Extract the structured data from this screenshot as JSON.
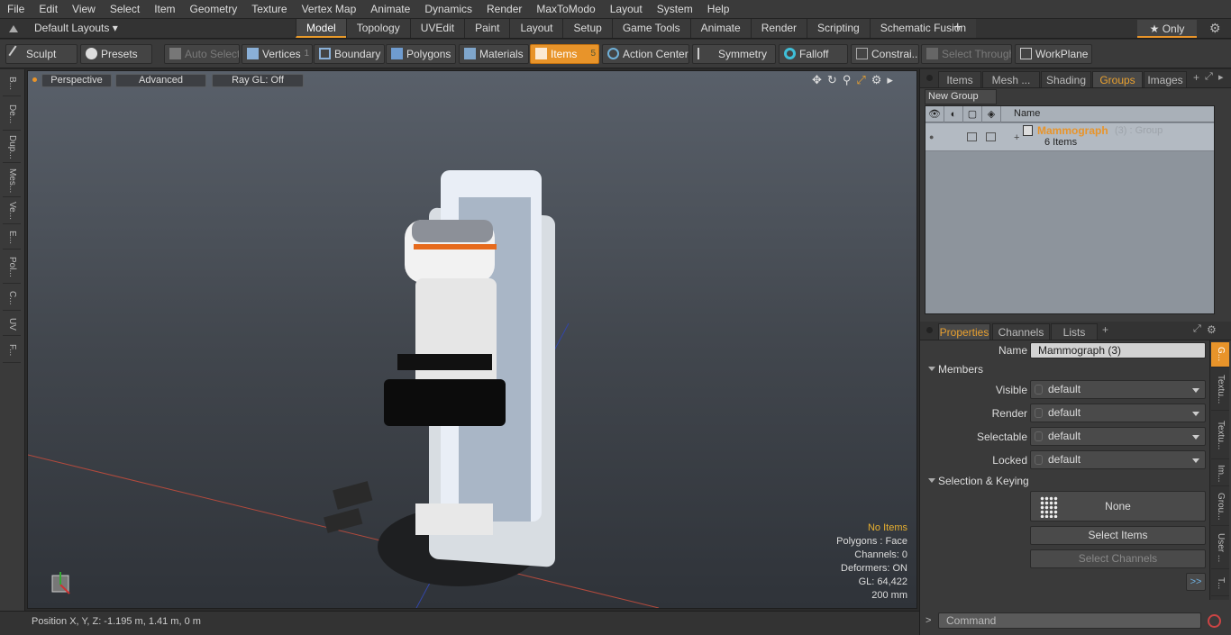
{
  "menu": [
    "File",
    "Edit",
    "View",
    "Select",
    "Item",
    "Geometry",
    "Texture",
    "Vertex Map",
    "Animate",
    "Dynamics",
    "Render",
    "MaxToModo",
    "Layout",
    "System",
    "Help"
  ],
  "layouts": {
    "label": "Default Layouts ▾"
  },
  "mode_tabs": [
    "Model",
    "Topology",
    "UVEdit",
    "Paint",
    "Layout",
    "Setup",
    "Game Tools",
    "Animate",
    "Render",
    "Scripting",
    "Schematic Fusion"
  ],
  "only_label": "★ Only",
  "toolbar": {
    "sculpt": "Sculpt",
    "presets": "Presets",
    "auto_select": "Auto Select",
    "vertices": "Vertices",
    "vertices_count": "1",
    "boundary": "Boundary",
    "polygons": "Polygons",
    "materials": "Materials",
    "items": "Items",
    "items_count": "5",
    "action_center": "Action Center",
    "symmetry": "Symmetry",
    "falloff": "Falloff",
    "constrain": "Constrai...",
    "select_through": "Select Through",
    "workplane": "WorkPlane"
  },
  "left_tabs": [
    "B...",
    "De...",
    "Dup...",
    "Mes...",
    "Ve...",
    "E...",
    "Pol...",
    "C...",
    "UV",
    "F..."
  ],
  "viewport": {
    "perspective": "Perspective",
    "advanced": "Advanced",
    "raygl": "Ray GL: Off",
    "stats": {
      "no_items": "No Items",
      "polygons": "Polygons : Face",
      "channels": "Channels: 0",
      "deformers": "Deformers: ON",
      "gl": "GL: 64,422",
      "scale": "200 mm"
    }
  },
  "status": {
    "position": "Position X, Y, Z:   -1.195 m, 1.41 m, 0 m"
  },
  "top_panel": {
    "tabs": [
      "Items",
      "Mesh ...",
      "Shading",
      "Groups",
      "Images"
    ],
    "new_group": "New Group",
    "name_header": "Name",
    "group": {
      "name": "Mammograph",
      "suffix": "(3) : Group",
      "items": "6 Items"
    }
  },
  "properties": {
    "tabs": [
      "Properties",
      "Channels",
      "Lists"
    ],
    "name_label": "Name",
    "name_value": "Mammograph (3)",
    "members": "Members",
    "visible_label": "Visible",
    "visible": "default",
    "render_label": "Render",
    "render": "default",
    "selectable_label": "Selectable",
    "selectable": "default",
    "locked_label": "Locked",
    "locked": "default",
    "sel_keying": "Selection & Keying",
    "none": "None",
    "select_items": "Select Items",
    "select_channels": "Select Channels",
    "more": ">>"
  },
  "right_tabs": [
    "G...",
    "Textu...",
    "Textu...",
    "Im...",
    "Grou...",
    "User ...",
    "T..."
  ],
  "command": {
    "placeholder": "Command",
    "prompt": ">"
  },
  "colors": {
    "accent": "#e8942a"
  }
}
